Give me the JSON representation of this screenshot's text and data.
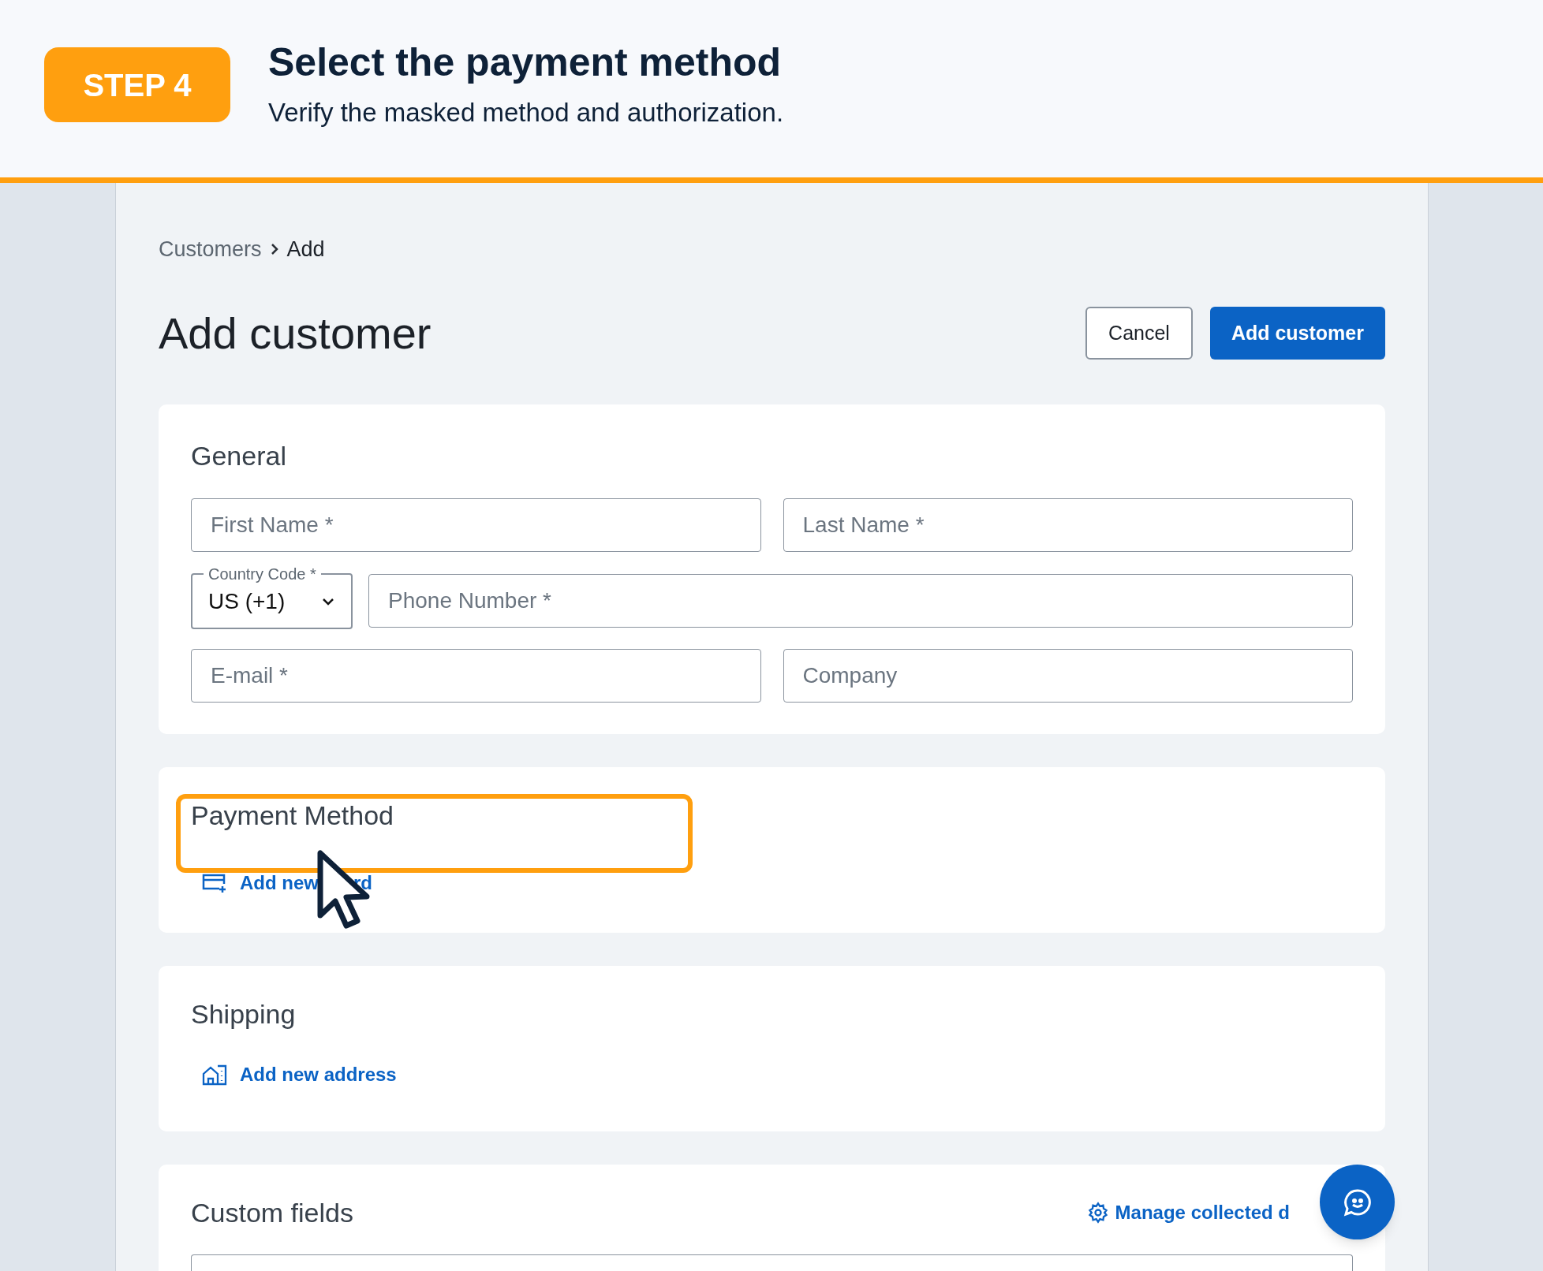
{
  "step": {
    "badge": "STEP 4",
    "title": "Select the payment method",
    "subtitle": "Verify the masked method and authorization."
  },
  "breadcrumb": [
    {
      "label": "Customers"
    },
    {
      "label": "Add"
    }
  ],
  "page_title": "Add customer",
  "actions": [
    {
      "label": "Cancel",
      "kind": "secondary"
    },
    {
      "label": "Add customer",
      "kind": "primary"
    }
  ],
  "general": {
    "title": "General",
    "first_name": {
      "placeholder": "First Name *"
    },
    "last_name": {
      "placeholder": "Last Name *"
    },
    "country_code": {
      "label": "Country Code *",
      "value": "US (+1)"
    },
    "phone": {
      "placeholder": "Phone Number *"
    },
    "email": {
      "placeholder": "E-mail *"
    },
    "company": {
      "placeholder": "Company"
    }
  },
  "payment": {
    "title": "Payment Method",
    "highlighted": true,
    "link": "Add new",
    "link_tail": "rd"
  },
  "shipping": {
    "title": "Shipping",
    "link": "Add new address"
  },
  "custom_fields": {
    "title": "Custom fields",
    "link": "Manage collected d"
  }
}
